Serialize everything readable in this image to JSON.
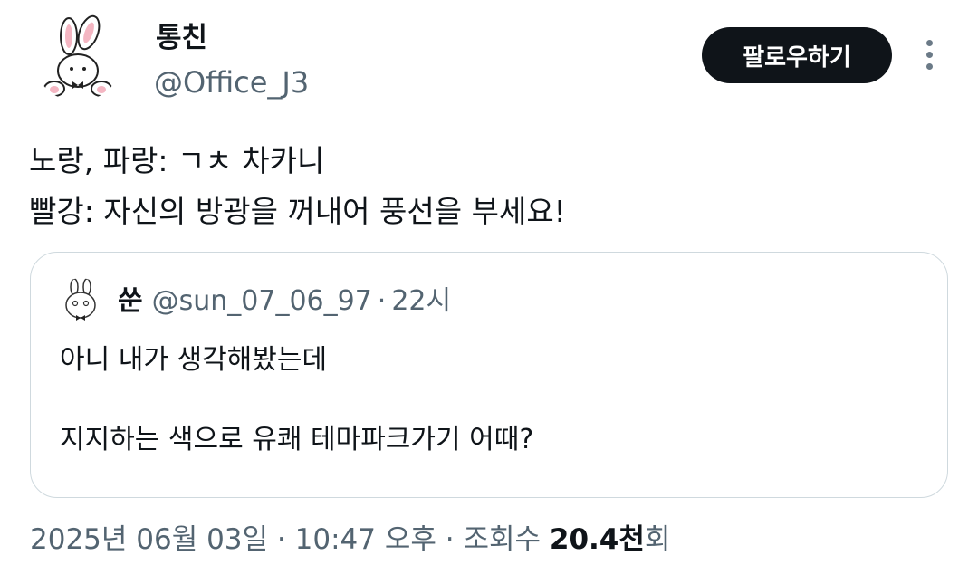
{
  "author": {
    "display_name": "통친",
    "handle": "@Office_J3"
  },
  "follow_button": {
    "label": "팔로우하기"
  },
  "more_menu": {
    "icon": "more-vertical-icon"
  },
  "tweet": {
    "lines": [
      "노랑, 파랑: ㄱㅊ 차카니",
      "빨강: 자신의 방광을 꺼내어 풍선을 부세요!"
    ]
  },
  "quote": {
    "display_name": "쑨",
    "handle": "@sun_07_06_97",
    "separator": "·",
    "time": "22시",
    "lines": [
      "아니 내가 생각해봤는데",
      "지지하는 색으로 유쾌 테마파크가기 어때?"
    ]
  },
  "meta": {
    "date": "2025년 06월 03일",
    "sep1": "·",
    "time": "10:47 오후",
    "sep2": "·",
    "views_label": "조회수",
    "views_count": "20.4천",
    "views_suffix": "회"
  },
  "colors": {
    "text_primary": "#0f1419",
    "text_secondary": "#536471",
    "border": "#cfd9de",
    "button_bg": "#0f1419"
  }
}
